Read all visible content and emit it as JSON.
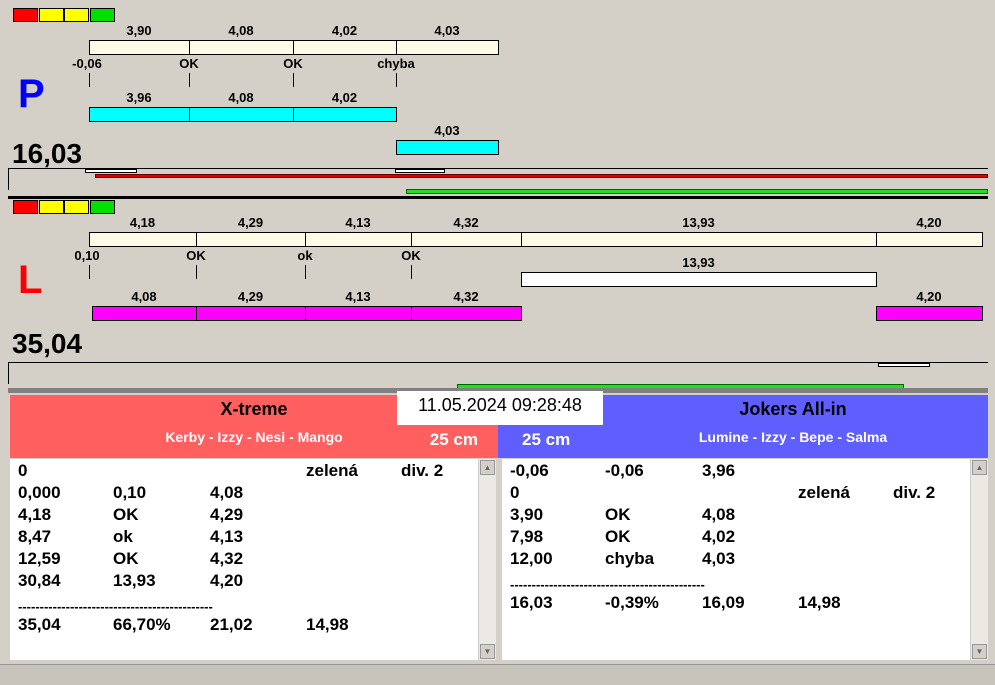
{
  "colors": {
    "red": "#ff0000",
    "yellow": "#ffff00",
    "green": "#00e000",
    "cream": "#fffbe6",
    "cyan": "#00ffff",
    "magenta": "#ff00ff",
    "team_left": "#ff5f5f",
    "team_right": "#5f5fff"
  },
  "P": {
    "letter": "P",
    "total": "16,03",
    "top": [
      "3,90",
      "4,08",
      "4,02",
      "4,03"
    ],
    "marks": [
      "-0,06",
      "OK",
      "OK",
      "chyba"
    ],
    "bottom": [
      "3,96",
      "4,08",
      "4,02"
    ],
    "extra": "4,03"
  },
  "L": {
    "letter": "L",
    "total": "35,04",
    "top": [
      "4,18",
      "4,29",
      "4,13",
      "4,32",
      "13,93",
      "4,20"
    ],
    "marks": [
      "0,10",
      "OK",
      "ok",
      "OK"
    ],
    "mid": "13,93",
    "bottom": [
      "4,08",
      "4,29",
      "4,13",
      "4,32",
      "4,20"
    ]
  },
  "datetime": "11.05.2024 09:28:48",
  "left_team": {
    "name": "X-treme",
    "players": "Kerby - Izzy - Nesi - Mango",
    "distance": "25 cm",
    "rows": [
      [
        "0",
        "",
        "",
        "zelená",
        "div. 2"
      ],
      [
        "0,000",
        "0,10",
        "4,08",
        "",
        ""
      ],
      [
        "4,18",
        "OK",
        "4,29",
        "",
        ""
      ],
      [
        "8,47",
        "ok",
        "4,13",
        "",
        ""
      ],
      [
        "12,59",
        "OK",
        "4,32",
        "",
        ""
      ],
      [
        "30,84",
        "13,93",
        "4,20",
        "",
        ""
      ],
      [
        "---------------------------------------------",
        "",
        "",
        "",
        ""
      ],
      [
        "35,04",
        "66,70%",
        "21,02",
        "14,98",
        ""
      ]
    ]
  },
  "right_team": {
    "name": "Jokers All-in",
    "players": "Lumine - Izzy - Bepe - Salma",
    "distance": "25 cm",
    "rows": [
      [
        "-0,06",
        "-0,06",
        "3,96",
        "",
        ""
      ],
      [
        "0",
        "",
        "",
        "zelená",
        "div. 2"
      ],
      [
        "3,90",
        "OK",
        "4,08",
        "",
        ""
      ],
      [
        "7,98",
        "OK",
        "4,02",
        "",
        ""
      ],
      [
        "12,00",
        "chyba",
        "4,03",
        "",
        ""
      ],
      [
        "---------------------------------------------",
        "",
        "",
        "",
        ""
      ],
      [
        "16,03",
        "-0,39%",
        "16,09",
        "14,98",
        ""
      ]
    ]
  }
}
